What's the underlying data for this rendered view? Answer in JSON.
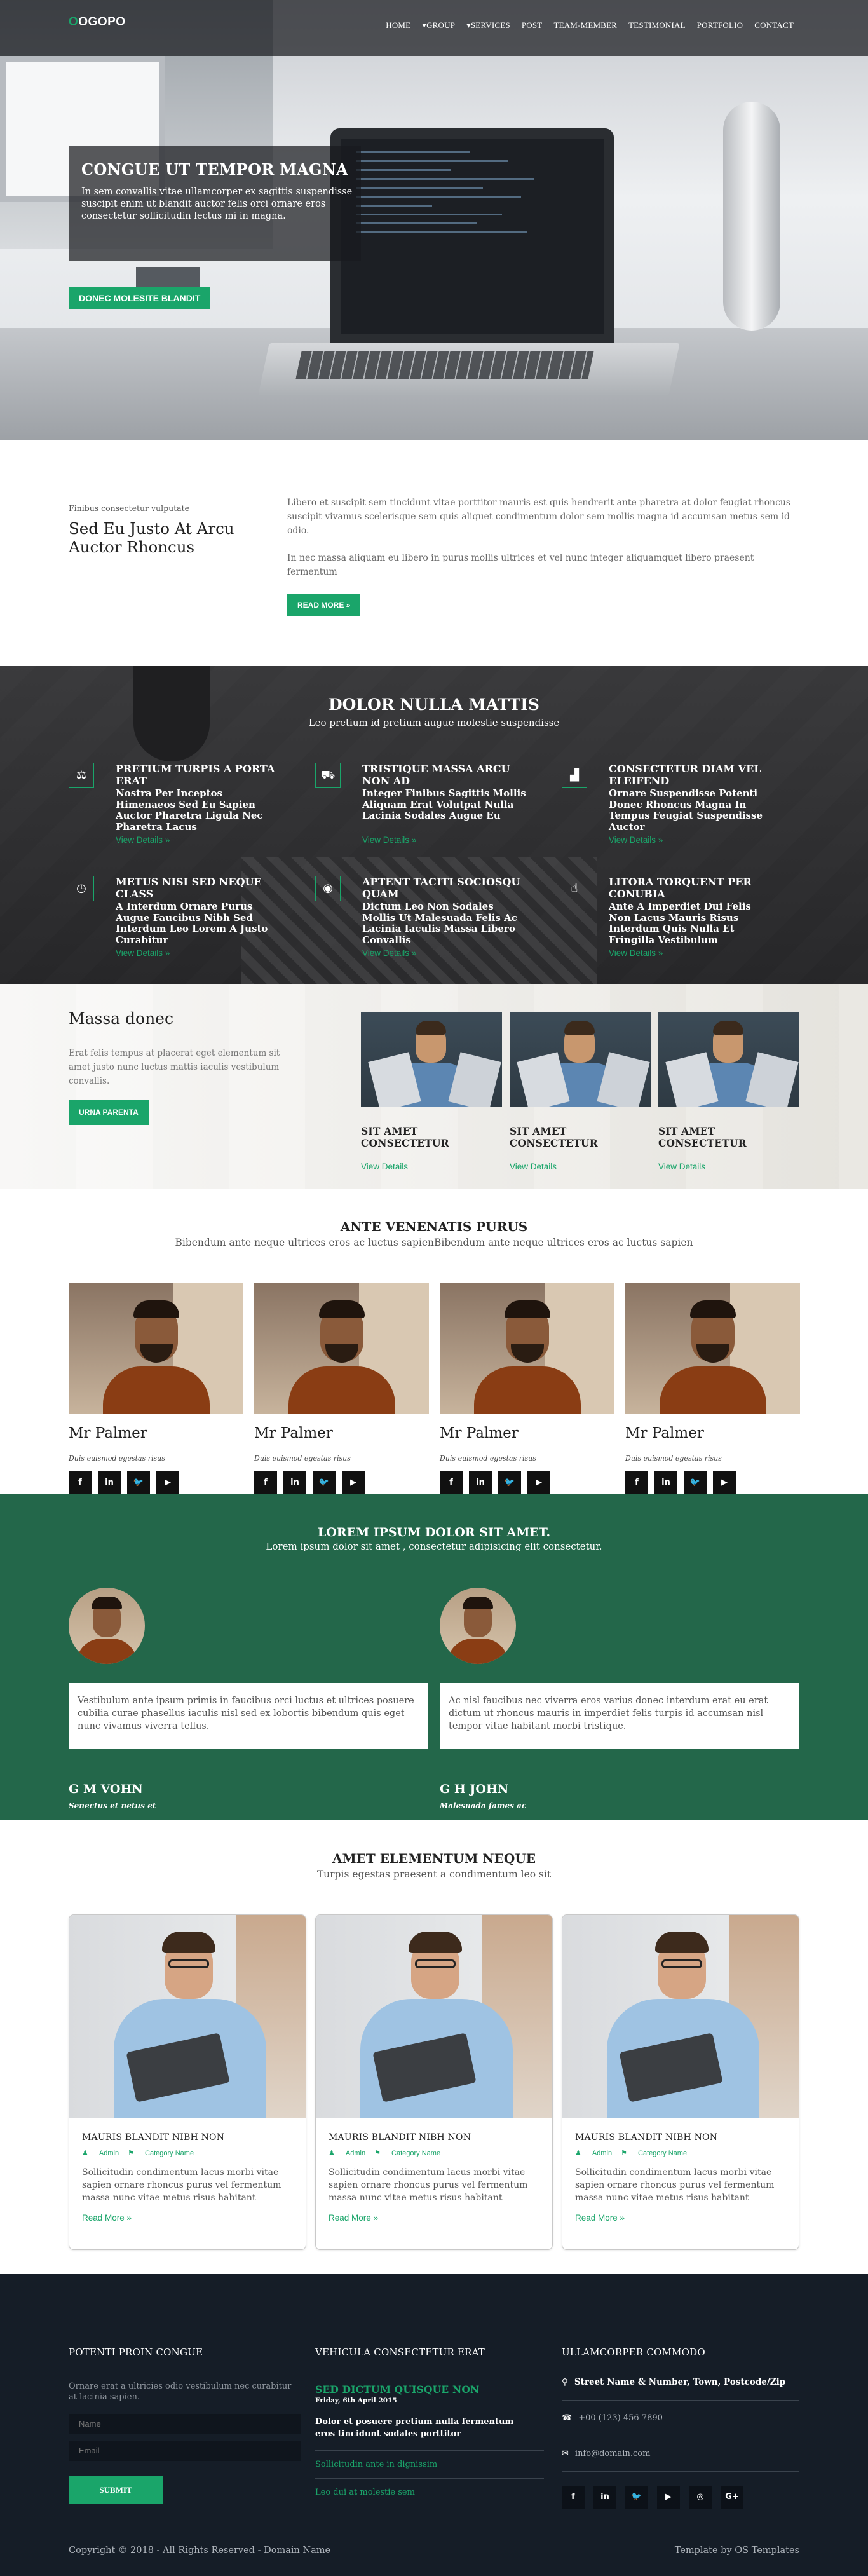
{
  "brand": {
    "logo_first": "O",
    "logo_rest": "OGOPO",
    "accent": "#1aa56a",
    "dark_green": "#23674a",
    "footer_bg": "#151d27"
  },
  "nav": [
    {
      "label": "HOME"
    },
    {
      "label": "GROUP",
      "dropdown": true
    },
    {
      "label": "SERVICES",
      "dropdown": true
    },
    {
      "label": "POST"
    },
    {
      "label": "TEAM-MEMBER"
    },
    {
      "label": "TESTIMONIAL"
    },
    {
      "label": "PORTFOLIO"
    },
    {
      "label": "CONTACT"
    }
  ],
  "hero": {
    "title": "CONGUE UT TEMPOR MAGNA",
    "text": "In sem convallis vitae ullamcorper ex sagittis suspendisse suscipit enim ut blandit auctor felis orci ornare eros consectetur sollicitudin lectus mi in magna.",
    "button": "DONEC MOLESITE BLANDIT"
  },
  "intro": {
    "pre": "Finibus consectetur vulputate",
    "heading": "Sed Eu Justo At Arcu Auctor Rhoncus",
    "p1": "Libero et suscipit sem tincidunt vitae porttitor mauris est quis hendrerit ante pharetra at dolor feugiat rhoncus suscipit vivamus scelerisque sem quis aliquet condimentum dolor sem mollis magna id accumsan metus sem id odio.",
    "p2": "In nec massa aliquam eu libero in purus mollis ultrices et vel nunc integer aliquamquet libero praesent fermentum",
    "button": "READ MORE »"
  },
  "services": {
    "title": "DOLOR NULLA MATTIS",
    "subtitle": "Leo pretium id pretium augue molestie suspendisse",
    "items": [
      {
        "icon": "chart-icon",
        "glyph": "⚖",
        "title": "PRETIUM TURPIS A PORTA ERAT",
        "text": "Nostra Per Inceptos Himenaeos Sed Eu Sapien Auctor Pharetra Ligula Nec Pharetra Lacus",
        "more": "View Details »"
      },
      {
        "icon": "truck-icon",
        "glyph": "⛟",
        "title": "TRISTIQUE MASSA ARCU NON AD",
        "text": "Integer Finibus Sagittis Mollis Aliquam Erat Volutpat Nulla Lacinia Sodales Augue Eu",
        "more": "View Details »"
      },
      {
        "icon": "bar-chart-icon",
        "glyph": "▟",
        "title": "CONSECTETUR DIAM VEL ELEIFEND",
        "text": "Ornare Suspendisse Potenti Donec Rhoncus Magna In Tempus Feugiat Suspendisse Auctor",
        "more": "View Details »"
      },
      {
        "icon": "clock-icon",
        "glyph": "◷",
        "title": "METUS NISI SED NEQUE CLASS",
        "text": "A Interdum Ornare Purus Augue Faucibus Nibh Sed Interdum Leo Lorem A Justo Curabitur",
        "more": "View Details »"
      },
      {
        "icon": "gamepad-icon",
        "glyph": "◉",
        "title": "APTENT TACITI SOCIOSQU QUAM",
        "text": "Dictum Leo Non Sodales Mollis Ut Malesuada Felis Ac Lacinia Iaculis Massa Libero Convallis",
        "more": "View Details »"
      },
      {
        "icon": "thumbs-up-icon",
        "glyph": "☝",
        "title": "LITORA TORQUENT PER CONUBIA",
        "text": "Ante A Imperdiet Dui Felis Non Lacus Mauris Risus Interdum Quis Nulla Et Fringilla Vestibulum",
        "more": "View Details »"
      }
    ]
  },
  "massa": {
    "title": "Massa donec",
    "text": "Erat felis tempus at placerat eget elementum sit amet justo nunc luctus mattis iaculis vestibulum convallis.",
    "button": "URNA PARENTA",
    "cards": [
      {
        "title": "SIT AMET CONSECTETUR",
        "more": "View Details"
      },
      {
        "title": "SIT AMET CONSECTETUR",
        "more": "View Details"
      },
      {
        "title": "SIT AMET CONSECTETUR",
        "more": "View Details"
      }
    ]
  },
  "staff": {
    "title": "ANTE VENENATIS PURUS",
    "subtitle": "Bibendum ante neque ultrices eros ac luctus sapienBibendum ante neque ultrices eros ac luctus sapien",
    "members": [
      {
        "name": "Mr Palmer",
        "role": "Duis euismod egestas risus"
      },
      {
        "name": "Mr Palmer",
        "role": "Duis euismod egestas risus"
      },
      {
        "name": "Mr Palmer",
        "role": "Duis euismod egestas risus"
      },
      {
        "name": "Mr Palmer",
        "role": "Duis euismod egestas risus"
      }
    ],
    "social": [
      {
        "icon": "facebook-icon",
        "glyph": "f"
      },
      {
        "icon": "linkedin-icon",
        "glyph": "in"
      },
      {
        "icon": "twitter-icon",
        "glyph": "🐦"
      },
      {
        "icon": "youtube-icon",
        "glyph": "▶"
      }
    ]
  },
  "testimonials": {
    "title": "LOREM IPSUM DOLOR SIT AMET.",
    "subtitle": "Lorem ipsum dolor sit amet , consectetur adipisicing elit consectetur.",
    "items": [
      {
        "quote": "Vestibulum ante ipsum primis in faucibus orci luctus et ultrices posuere cubilia curae phasellus iaculis nisl sed ex lobortis bibendum quis eget nunc vivamus viverra tellus.",
        "name": "G M VOHN",
        "role": "Senectus et netus et"
      },
      {
        "quote": "Ac nisl faucibus nec viverra eros varius donec interdum erat eu erat dictum ut rhoncus mauris in imperdiet felis turpis id accumsan nisl tempor vitae habitant morbi tristique.",
        "name": "G H JOHN",
        "role": "Malesuada fames ac"
      }
    ]
  },
  "blog": {
    "title": "AMET ELEMENTUM NEQUE",
    "subtitle": "Turpis egestas praesent a condimentum leo sit",
    "posts": [
      {
        "title": "MAURIS BLANDIT NIBH NON",
        "author": "Admin",
        "category": "Category Name",
        "text": "Sollicitudin condimentum lacus morbi vitae sapien ornare rhoncus purus vel fermentum massa nunc vitae metus risus habitant",
        "more": "Read More »"
      },
      {
        "title": "MAURIS BLANDIT NIBH NON",
        "author": "Admin",
        "category": "Category Name",
        "text": "Sollicitudin condimentum lacus morbi vitae sapien ornare rhoncus purus vel fermentum massa nunc vitae metus risus habitant",
        "more": "Read More »"
      },
      {
        "title": "MAURIS BLANDIT NIBH NON",
        "author": "Admin",
        "category": "Category Name",
        "text": "Sollicitudin condimentum lacus morbi vitae sapien ornare rhoncus purus vel fermentum massa nunc vitae metus risus habitant",
        "more": "Read More »"
      }
    ]
  },
  "footer": {
    "col1": {
      "title": "POTENTI PROIN CONGUE",
      "text": "Ornare erat a ultricies odio vestibulum nec curabitur at lacinia sapien.",
      "name_placeholder": "Name",
      "email_placeholder": "Email",
      "button": "SUBMIT"
    },
    "col2": {
      "title": "VEHICULA CONSECTETUR ERAT",
      "headline": "SED DICTUM QUISQUE NON",
      "date": "Friday, 6th April 2015",
      "text": "Dolor et posuere pretium nulla fermentum eros tincidunt sodales porttitor",
      "link1": "Sollicitudin ante in dignissim",
      "link2": "Leo dui at molestie sem"
    },
    "col3": {
      "title": "ULLAMCORPER COMMODO",
      "address": "Street Name & Number, Town, Postcode/Zip",
      "phone": "+00 (123) 456 7890",
      "email": "info@domain.com",
      "social": [
        {
          "icon": "facebook-icon",
          "glyph": "f"
        },
        {
          "icon": "linkedin-icon",
          "glyph": "in"
        },
        {
          "icon": "twitter-icon",
          "glyph": "🐦"
        },
        {
          "icon": "youtube-icon",
          "glyph": "▶"
        },
        {
          "icon": "instagram-icon",
          "glyph": "◎"
        },
        {
          "icon": "google-plus-icon",
          "glyph": "G+"
        }
      ]
    },
    "copyright": "Copyright © 2018 - All Rights Reserved - Domain Name",
    "credit": "Template by OS Templates"
  }
}
